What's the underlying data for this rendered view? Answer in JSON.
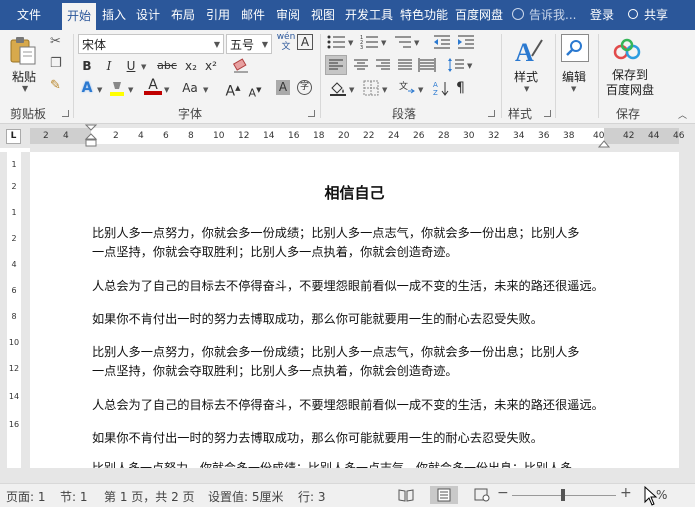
{
  "menu": {
    "tabs": [
      "文件",
      "开始",
      "插入",
      "设计",
      "布局",
      "引用",
      "邮件",
      "审阅",
      "视图",
      "开发工具",
      "特色功能",
      "百度网盘"
    ],
    "active_tab": "开始",
    "tell_me": "告诉我...",
    "login": "登录",
    "share": "共享"
  },
  "ribbon": {
    "clipboard": {
      "paste": "粘贴",
      "label": "剪贴板"
    },
    "font": {
      "font_name": "宋体",
      "font_size": "五号",
      "wen": "wén",
      "label": "字体",
      "bold": "B",
      "italic": "I",
      "underline": "U",
      "strike": "abc",
      "sub": "x₂",
      "sup": "x²",
      "aa": "Aa",
      "grow": "A",
      "shrink": "A",
      "shade": "A"
    },
    "paragraph": {
      "label": "段落"
    },
    "styles": {
      "button": "样式",
      "label": "样式"
    },
    "editing": {
      "button": "编辑"
    },
    "save": {
      "button_line1": "保存到",
      "button_line2": "百度网盘",
      "label": "保存"
    }
  },
  "ruler": {
    "corner": "L",
    "numbers": [
      "4",
      "2",
      "2",
      "4",
      "6",
      "8",
      "10",
      "12",
      "14",
      "16",
      "18",
      "20",
      "22",
      "24",
      "26",
      "28",
      "30",
      "32",
      "34",
      "36",
      "38",
      "40",
      "42",
      "44",
      "46"
    ]
  },
  "vruler": [
    "1",
    "2",
    "1",
    "2",
    "4",
    "6",
    "8",
    "10",
    "12",
    "14",
    "16"
  ],
  "document": {
    "title": "相信自己",
    "paragraphs": [
      [
        "比别人多一点努力，你就会多一份成绩；比别人多一点志气，你就会多一份出息；比别人多",
        "一点坚持，你就会夺取胜利；比别人多一点执着，你就会创造奇迹。"
      ],
      [
        "人总会为了自己的目标去不停得奋斗，不要埋怨眼前看似一成不变的生活，未来的路还很遥远。"
      ],
      [
        "如果你不肯付出一时的努力去博取成功，那么你可能就要用一生的耐心去忍受失败。"
      ],
      [
        "比别人多一点努力，你就会多一份成绩；比别人多一点志气，你就会多一份出息；比别人多",
        "一点坚持，你就会夺取胜利；比别人多一点执着，你就会创造奇迹。"
      ],
      [
        "人总会为了自己的目标去不停得奋斗，不要埋怨眼前看似一成不变的生活，未来的路还很遥远。"
      ],
      [
        "如果你不肯付出一时的努力去博取成功，那么你可能就要用一生的耐心去忍受失败。"
      ]
    ],
    "cut_line": "比别人多一点努力，你就会多一份成绩；比别人多一点志气，你就会多一份出息；比别人多"
  },
  "status": {
    "page": "页面: 1",
    "section": "节: 1",
    "page_of": "第 1 页，共 2 页",
    "position": "设置值: 5厘米",
    "row": "行: 3",
    "zoom": "%"
  },
  "colors": {
    "brand": "#2b579a",
    "font_color": "#c00000",
    "highlight": "#ffff00"
  }
}
